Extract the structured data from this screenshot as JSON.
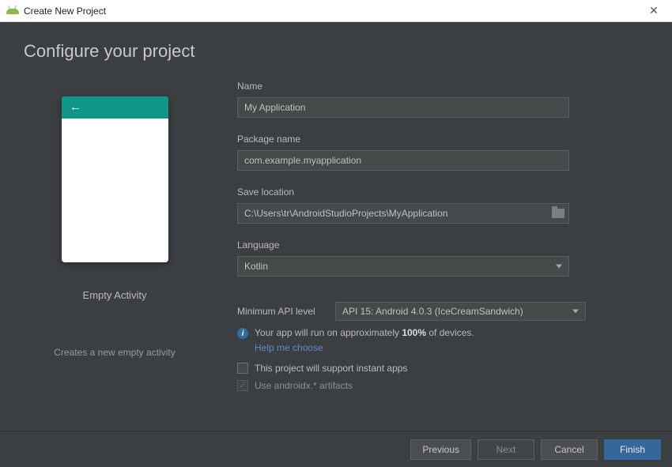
{
  "window": {
    "title": "Create New Project"
  },
  "heading": "Configure your project",
  "preview": {
    "activity_title": "Empty Activity",
    "activity_desc": "Creates a new empty activity"
  },
  "form": {
    "name_label": "Name",
    "name_value": "My Application",
    "package_label": "Package name",
    "package_value": "com.example.myapplication",
    "location_label": "Save location",
    "location_value": "C:\\Users\\tr\\AndroidStudioProjects\\MyApplication",
    "language_label": "Language",
    "language_value": "Kotlin",
    "api_label": "Minimum API level",
    "api_value": "API 15: Android 4.0.3 (IceCreamSandwich)",
    "api_info_prefix": "Your app will run on approximately ",
    "api_info_pct": "100%",
    "api_info_suffix": " of devices.",
    "help_link": "Help me choose",
    "instant_apps_label": "This project will support instant apps",
    "androidx_label": "Use androidx.* artifacts"
  },
  "buttons": {
    "previous": "Previous",
    "next": "Next",
    "cancel": "Cancel",
    "finish": "Finish"
  }
}
